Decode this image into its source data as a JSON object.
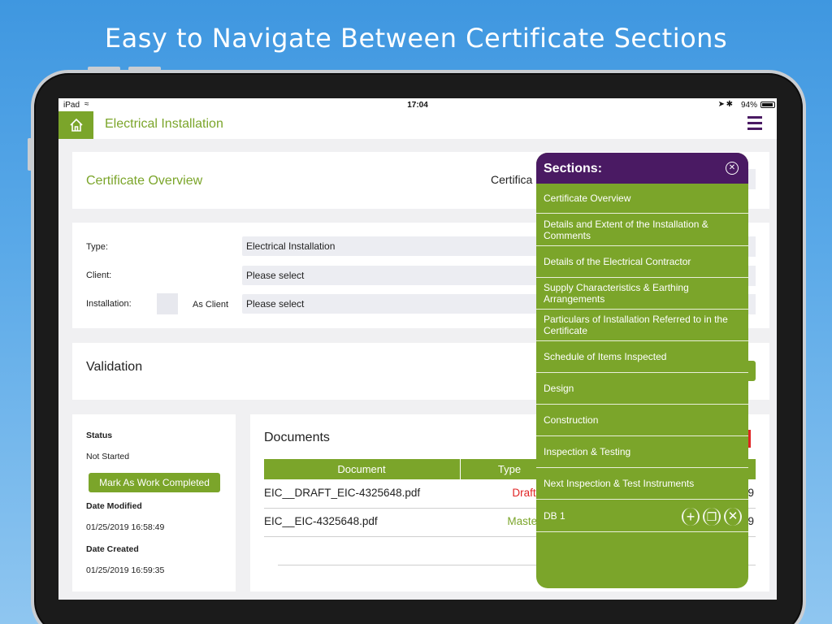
{
  "headline": "Easy to Navigate Between Certificate Sections",
  "status_bar": {
    "device": "iPad",
    "time": "17:04",
    "battery": "94%"
  },
  "nav": {
    "title": "Electrical Installation"
  },
  "overview": {
    "title": "Certificate Overview",
    "certificate_label": "Certifica"
  },
  "form": {
    "type_label": "Type:",
    "type_value": "Electrical Installation",
    "client_label": "Client:",
    "client_value": "Please select",
    "installation_label": "Installation:",
    "as_client_label": "As Client",
    "installation_value": "Please select"
  },
  "validation": {
    "title": "Validation"
  },
  "status_panel": {
    "status_label": "Status",
    "status_value": "Not Started",
    "mark_button": "Mark As Work Completed",
    "date_modified_label": "Date Modified",
    "date_modified_value": "01/25/2019 16:58:49",
    "date_created_label": "Date Created",
    "date_created_value": "01/25/2019 16:59:35"
  },
  "documents": {
    "title": "Documents",
    "columns": [
      "Document",
      "Type"
    ],
    "rows": [
      {
        "name": "EIC__DRAFT_EIC-4325648.pdf",
        "type": "Draft",
        "type_color": "#e02424",
        "tail": "9"
      },
      {
        "name": "EIC__EIC-4325648.pdf",
        "type": "Master",
        "type_color": "#7ba52a",
        "tail": "9"
      }
    ]
  },
  "sections": {
    "title": "Sections:",
    "items": [
      "Certificate Overview",
      "Details and Extent of the Installation & Comments",
      "Details of the Electrical Contractor",
      "Supply Characteristics & Earthing Arrangements",
      "Particulars of Installation Referred to in the Certificate",
      "Schedule of Items Inspected",
      "Design",
      "Construction",
      "Inspection & Testing",
      "Next Inspection & Test Instruments",
      "DB 1"
    ]
  },
  "colors": {
    "accent_green": "#7ba52a",
    "header_purple": "#4a1a63"
  },
  "icons": [
    "home-icon",
    "hamburger-menu-icon",
    "close-circle-icon",
    "add-icon",
    "copy-icon",
    "delete-icon"
  ]
}
